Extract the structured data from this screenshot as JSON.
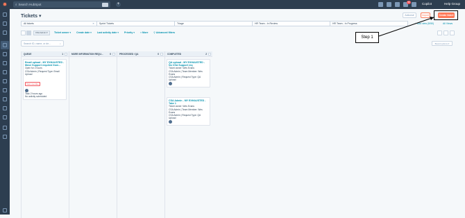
{
  "topbar": {
    "search_placeholder": "Search HubSpot",
    "copilot": "Copilot",
    "account": "Help Group",
    "notification_count": "99"
  },
  "header": {
    "title": "Tickets",
    "actions_label": "Actions",
    "import_label": "Import",
    "create_label": "Create ticket"
  },
  "views": {
    "tabs": [
      "All tickets",
      "Sprint Tickets",
      "Triage",
      "HR Team - In Review",
      "HR Team - In Progress"
    ],
    "add_view": "Add view (5/50)",
    "all_views": "All Views"
  },
  "filters": {
    "pipeline": "CSA Admin",
    "items": [
      "Ticket owner",
      "Create date",
      "Last activity date",
      "Priority",
      "More",
      "Advanced filters"
    ]
  },
  "search": {
    "placeholder": "Search ID, name, or de..."
  },
  "board_actions": "Board options",
  "columns": [
    {
      "name": "QUEUE",
      "count": "1"
    },
    {
      "name": "MORE INFORMATION REQU...",
      "count": "0"
    },
    {
      "name": "PROCESSED / QA",
      "count": "0"
    },
    {
      "name": "COMPLETED",
      "count": "2"
    }
  ],
  "cards": {
    "queue": {
      "title": "Email upload - MY EXHAUSTED - Move Support required from...",
      "status": "Open for 2 hours",
      "team": "CSA Admin | Request Type: Email Upload",
      "tag": "Task overdue",
      "task": "Task 2 hours ago",
      "activity": "No activity scheduled"
    },
    "completed1": {
      "title": "QA upload - MY EXHAUSTED - No CSA Support req",
      "owner": "Ticket owner: Wes Evans",
      "team": "CSA Admin | Team Member: Wes Evans",
      "request": "CSA Admin | Request Type: QA Upload"
    },
    "completed2": {
      "title": "CSA Admin - MY EXHAUSTED - Take 1",
      "owner": "Ticket owner: Wes Evans",
      "team": "CSA Admin | Team Member: Wes Evans",
      "request": "CSA Admin | Request Type: QA Upload"
    }
  },
  "annotation": {
    "step_label": "Step 1"
  },
  "colors": {
    "accent": "#ff7a59",
    "link": "#0091ae",
    "nav": "#2d3e50"
  }
}
